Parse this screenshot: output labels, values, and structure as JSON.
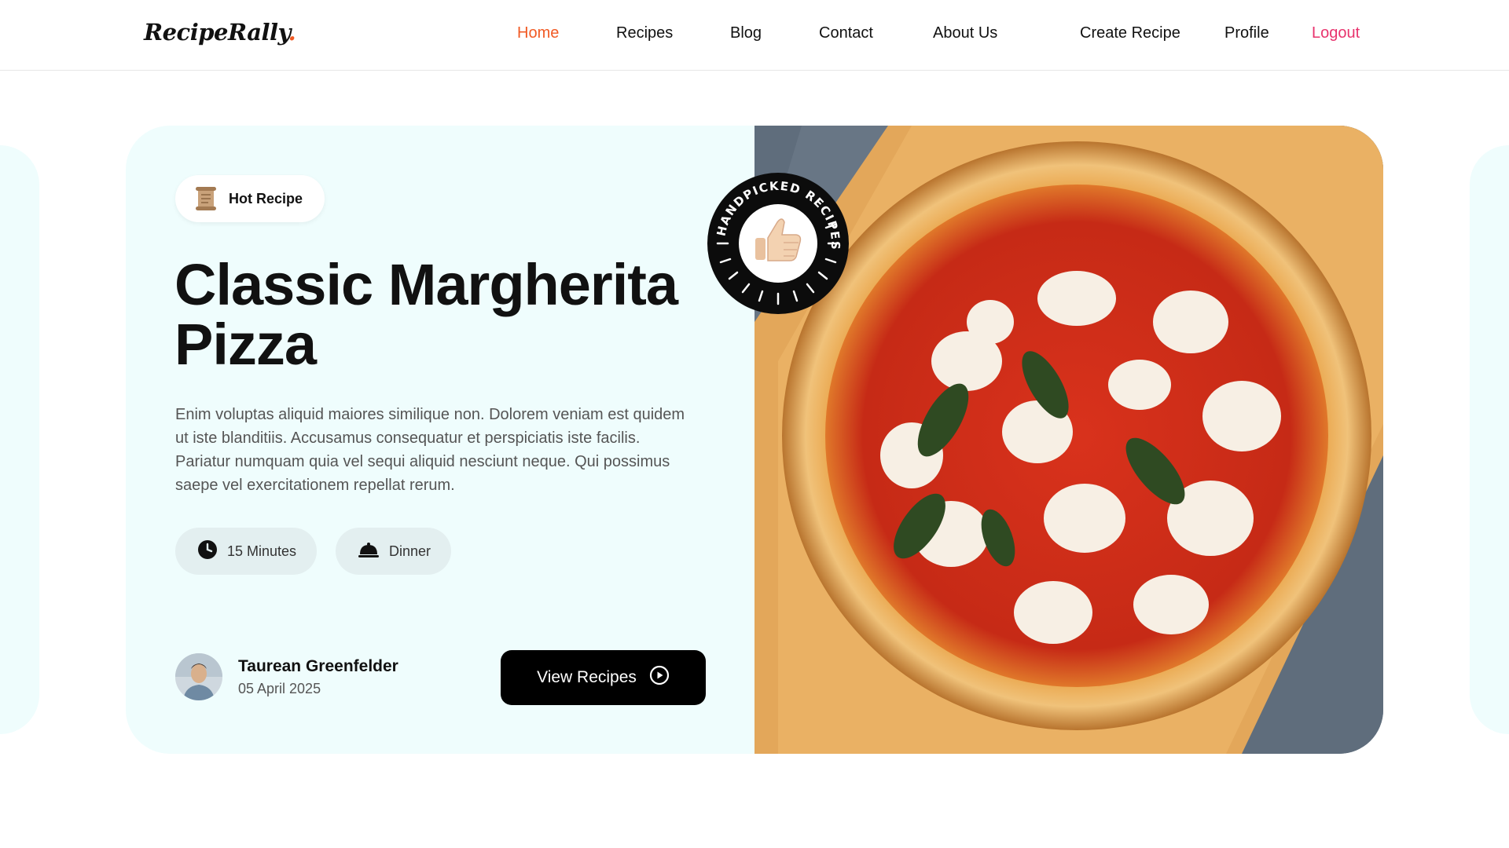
{
  "brand": {
    "name": "RecipeRally",
    "dot": ".",
    "accent_color": "#f15a24"
  },
  "nav": {
    "home": "Home",
    "recipes": "Recipes",
    "blog": "Blog",
    "contact": "Contact",
    "about": "About Us",
    "create_recipe": "Create Recipe",
    "profile": "Profile",
    "logout": "Logout"
  },
  "hero": {
    "badge_label": "Hot Recipe",
    "badge_icon": "scroll-icon",
    "title": "Classic Margherita Pizza",
    "description": "Enim voluptas aliquid maiores similique non. Dolorem veniam est quidem ut iste blanditiis. Accusamus consequatur et perspiciatis iste facilis. Pariatur numquam quia vel sequi aliquid nesciunt neque. Qui possimus saepe vel exercitationem repellat rerum.",
    "time": {
      "icon": "clock-icon",
      "label": "15 Minutes"
    },
    "meal": {
      "icon": "cloche-icon",
      "label": "Dinner"
    },
    "author": {
      "name": "Taurean Greenfelder",
      "date": "05 April 2025"
    },
    "cta_label": "View Recipes",
    "cta_icon": "play-circle-icon",
    "stamp_text": "HANDPICKED RECIPES",
    "stamp_icon": "thumbs-up-icon"
  },
  "colors": {
    "card_bg": "#effdfd",
    "chip_bg": "#e3eff0",
    "logout": "#e8336d"
  }
}
